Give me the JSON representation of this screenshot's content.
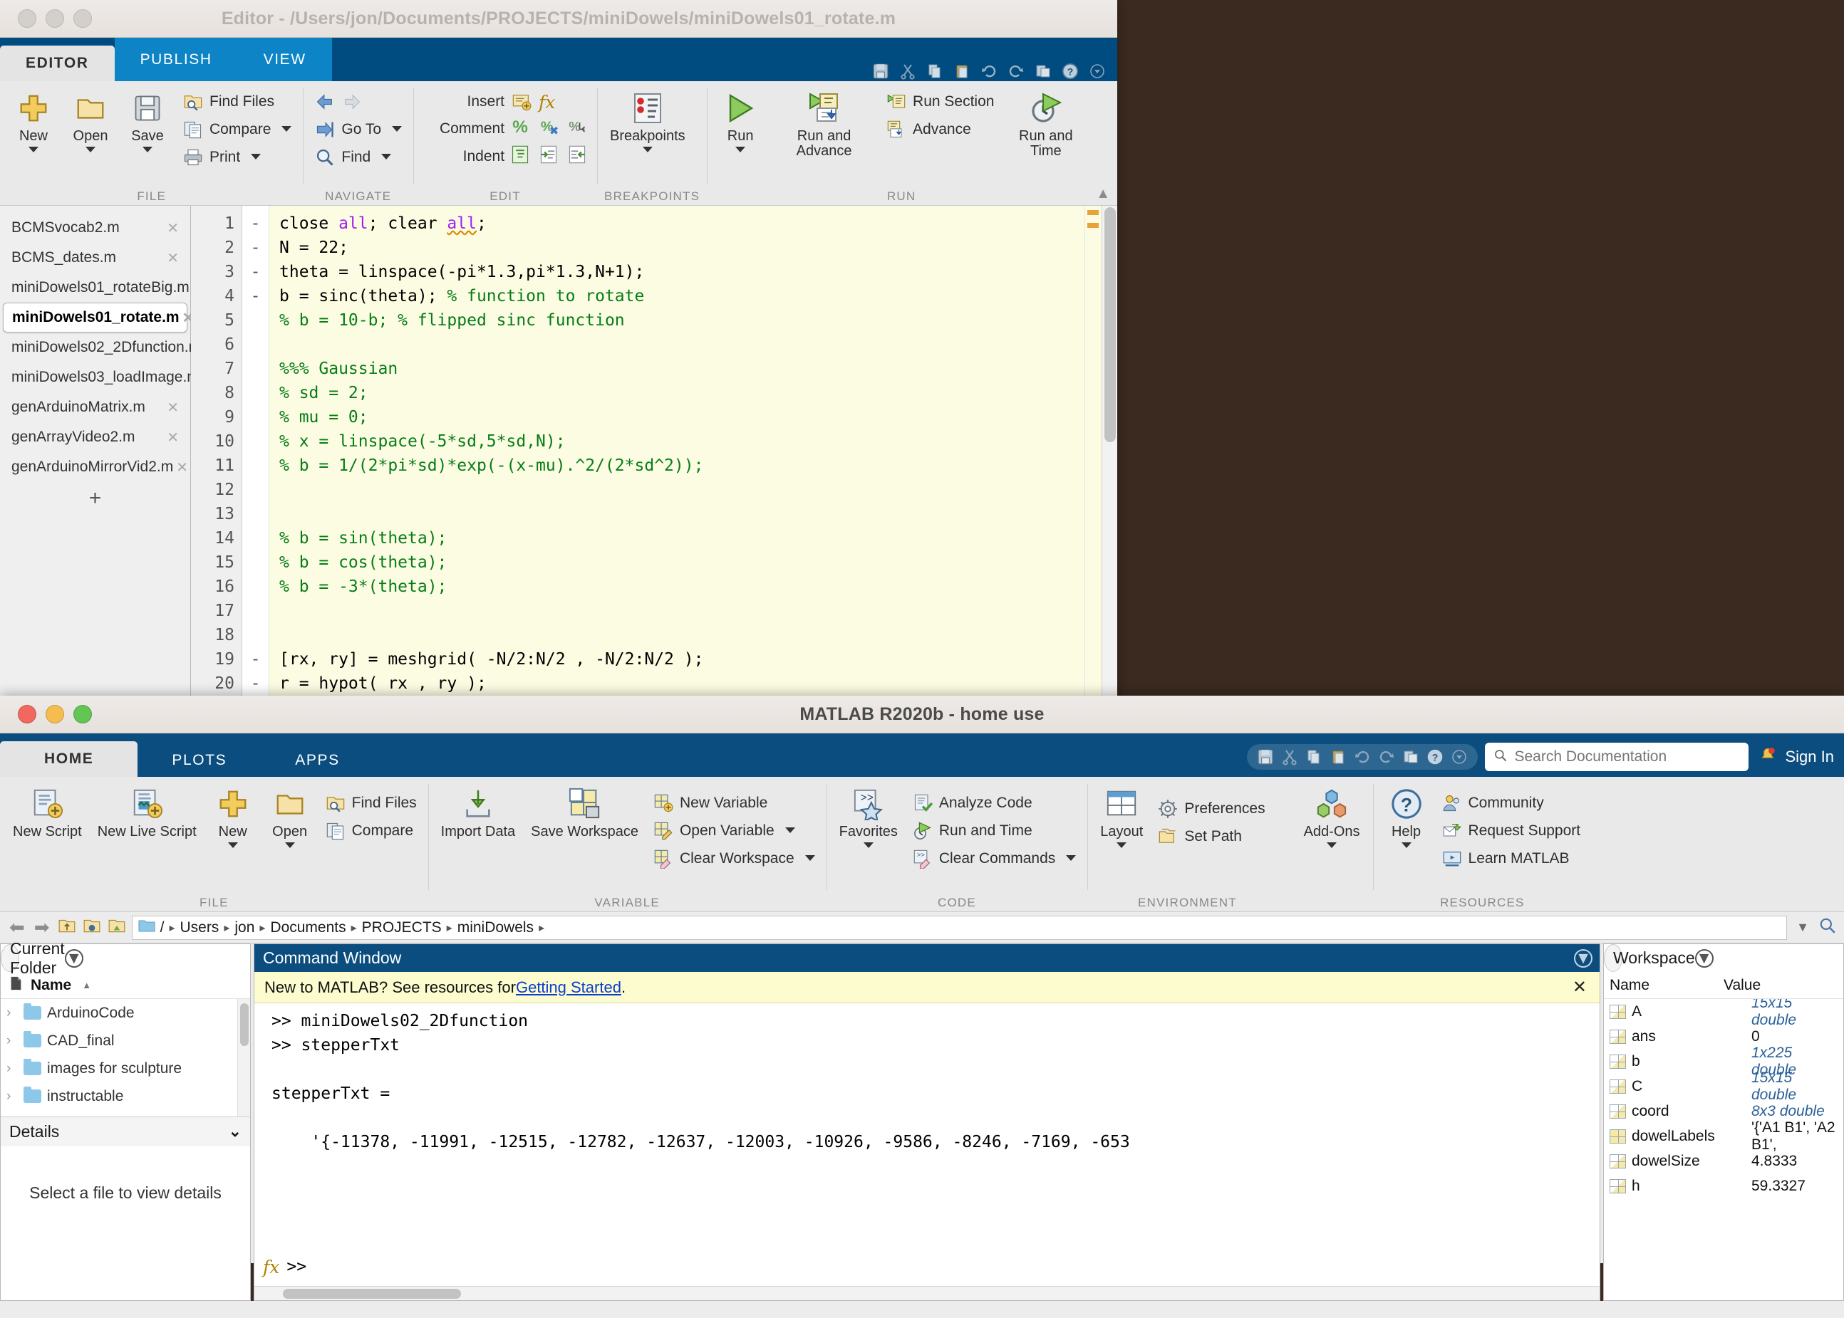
{
  "editor_window": {
    "title": "Editor - /Users/jon/Documents/PROJECTS/miniDowels/miniDowels01_rotate.m",
    "tabs": [
      {
        "label": "EDITOR",
        "active": true
      },
      {
        "label": "PUBLISH",
        "active": false
      },
      {
        "label": "VIEW",
        "active": false
      }
    ],
    "ribbon_groups": [
      {
        "name": "FILE",
        "big_buttons": [
          {
            "label": "New",
            "icon": "new-plus-icon",
            "has_caret": true
          },
          {
            "label": "Open",
            "icon": "open-folder-icon",
            "has_caret": true
          },
          {
            "label": "Save",
            "icon": "save-disk-icon",
            "has_caret": true
          }
        ],
        "small_buttons": [
          {
            "label": "Find Files",
            "icon": "find-files-icon",
            "has_caret": false
          },
          {
            "label": "Compare",
            "icon": "compare-icon",
            "has_caret": true
          },
          {
            "label": "Print",
            "icon": "print-icon",
            "has_caret": true
          }
        ]
      },
      {
        "name": "NAVIGATE",
        "small_buttons": [
          {
            "label": "",
            "icon": "back-arrow-icon",
            "has_caret": false
          },
          {
            "label": "Go To",
            "icon": "goto-icon",
            "has_caret": true
          },
          {
            "label": "Find",
            "icon": "find-magnifier-icon",
            "has_caret": true
          }
        ]
      },
      {
        "name": "EDIT",
        "rows": [
          {
            "label": "Insert",
            "icons": [
              "insert-block-icon",
              "fx-function-icon"
            ]
          },
          {
            "label": "Comment",
            "icons": [
              "comment-percent-icon",
              "uncomment-icon",
              "wrap-comment-icon"
            ]
          },
          {
            "label": "Indent",
            "icons": [
              "smart-indent-icon",
              "indent-right-icon",
              "indent-left-icon"
            ]
          }
        ]
      },
      {
        "name": "BREAKPOINTS",
        "big_buttons": [
          {
            "label": "Breakpoints",
            "icon": "breakpoints-icon",
            "has_caret": true
          }
        ]
      },
      {
        "name": "RUN",
        "big_buttons": [
          {
            "label": "Run",
            "icon": "run-play-icon",
            "has_caret": true
          },
          {
            "label": "Run and Advance",
            "icon": "run-advance-icon",
            "has_caret": false
          },
          {
            "label": "Run and Time",
            "icon": "run-time-icon",
            "has_caret": false
          }
        ],
        "small_buttons": [
          {
            "label": "Run Section",
            "icon": "run-section-icon",
            "has_caret": false
          },
          {
            "label": "Advance",
            "icon": "advance-icon",
            "has_caret": false
          }
        ]
      }
    ],
    "file_list": [
      {
        "name": "BCMSvocab2.m",
        "selected": false
      },
      {
        "name": "BCMS_dates.m",
        "selected": false
      },
      {
        "name": "miniDowels01_rotateBig.m",
        "selected": false
      },
      {
        "name": "miniDowels01_rotate.m",
        "selected": true
      },
      {
        "name": "miniDowels02_2Dfunction.m",
        "selected": false
      },
      {
        "name": "miniDowels03_loadImage.m",
        "selected": false
      },
      {
        "name": "genArduinoMatrix.m",
        "selected": false
      },
      {
        "name": "genArrayVideo2.m",
        "selected": false
      },
      {
        "name": "genArduinoMirrorVid2.m",
        "selected": false
      }
    ],
    "add_tab_label": "+",
    "code_lines": [
      {
        "n": "1",
        "bp": "-",
        "segs": [
          {
            "t": "close ",
            "c": "p"
          },
          {
            "t": "all",
            "c": "k"
          },
          {
            "t": "; clear ",
            "c": "p"
          },
          {
            "t": "all",
            "c": "kw"
          },
          {
            "t": ";",
            "c": "p"
          }
        ]
      },
      {
        "n": "2",
        "bp": "-",
        "segs": [
          {
            "t": "N = 22;",
            "c": "p"
          }
        ]
      },
      {
        "n": "3",
        "bp": "-",
        "segs": [
          {
            "t": "theta = linspace(-pi*1.3,pi*1.3,N+1);",
            "c": "p"
          }
        ]
      },
      {
        "n": "4",
        "bp": "-",
        "segs": [
          {
            "t": "b = sinc(theta); ",
            "c": "p"
          },
          {
            "t": "% function to rotate",
            "c": "c"
          }
        ]
      },
      {
        "n": "5",
        "bp": "",
        "segs": [
          {
            "t": "% b = 10-b; % flipped sinc function",
            "c": "c"
          }
        ]
      },
      {
        "n": "6",
        "bp": "",
        "segs": [
          {
            "t": "",
            "c": "p"
          }
        ]
      },
      {
        "n": "7",
        "bp": "",
        "segs": [
          {
            "t": "%%% Gaussian",
            "c": "c"
          }
        ]
      },
      {
        "n": "8",
        "bp": "",
        "segs": [
          {
            "t": "% sd = 2;",
            "c": "c"
          }
        ]
      },
      {
        "n": "9",
        "bp": "",
        "segs": [
          {
            "t": "% mu = 0;",
            "c": "c"
          }
        ]
      },
      {
        "n": "10",
        "bp": "",
        "segs": [
          {
            "t": "% x = linspace(-5*sd,5*sd,N);",
            "c": "c"
          }
        ]
      },
      {
        "n": "11",
        "bp": "",
        "segs": [
          {
            "t": "% b = 1/(2*pi*sd)*exp(-(x-mu).^2/(2*sd^2));",
            "c": "c"
          }
        ]
      },
      {
        "n": "12",
        "bp": "",
        "segs": [
          {
            "t": "",
            "c": "p"
          }
        ]
      },
      {
        "n": "13",
        "bp": "",
        "segs": [
          {
            "t": "",
            "c": "p"
          }
        ]
      },
      {
        "n": "14",
        "bp": "",
        "segs": [
          {
            "t": "% b = sin(theta);",
            "c": "c"
          }
        ]
      },
      {
        "n": "15",
        "bp": "",
        "segs": [
          {
            "t": "% b = cos(theta);",
            "c": "c"
          }
        ]
      },
      {
        "n": "16",
        "bp": "",
        "segs": [
          {
            "t": "% b = -3*(theta);",
            "c": "c"
          }
        ]
      },
      {
        "n": "17",
        "bp": "",
        "segs": [
          {
            "t": "",
            "c": "p"
          }
        ]
      },
      {
        "n": "18",
        "bp": "",
        "segs": [
          {
            "t": "",
            "c": "p"
          }
        ]
      },
      {
        "n": "19",
        "bp": "-",
        "segs": [
          {
            "t": "[rx, ry] = meshgrid( -N/2:N/2 , -N/2:N/2 );",
            "c": "p"
          }
        ]
      },
      {
        "n": "20",
        "bp": "-",
        "segs": [
          {
            "t": "r = hypot( rx , ry );",
            "c": "p"
          }
        ]
      }
    ]
  },
  "matlab_window": {
    "title": "MATLAB R2020b - home use",
    "tabs": [
      {
        "label": "HOME",
        "active": true
      },
      {
        "label": "PLOTS",
        "active": false
      },
      {
        "label": "APPS",
        "active": false
      }
    ],
    "search": {
      "placeholder": "Search Documentation",
      "value": ""
    },
    "sign_in_label": "Sign In",
    "ribbon_groups": [
      {
        "name": "FILE",
        "big_buttons": [
          {
            "label": "New Script",
            "icon": "new-script-icon",
            "has_caret": false
          },
          {
            "label": "New Live Script",
            "icon": "new-live-script-icon",
            "has_caret": false
          },
          {
            "label": "New",
            "icon": "new-plus-icon",
            "has_caret": true
          },
          {
            "label": "Open",
            "icon": "open-folder-icon",
            "has_caret": true
          }
        ],
        "small_buttons": [
          {
            "label": "Find Files",
            "icon": "find-files-icon",
            "has_caret": false
          },
          {
            "label": "Compare",
            "icon": "compare-icon",
            "has_caret": false
          }
        ]
      },
      {
        "name": "VARIABLE",
        "big_buttons": [
          {
            "label": "Import Data",
            "icon": "import-data-icon",
            "has_caret": false
          },
          {
            "label": "Save Workspace",
            "icon": "save-workspace-icon",
            "has_caret": false
          }
        ],
        "small_buttons": [
          {
            "label": "New Variable",
            "icon": "new-variable-icon",
            "has_caret": false
          },
          {
            "label": "Open Variable",
            "icon": "open-variable-icon",
            "has_caret": true
          },
          {
            "label": "Clear Workspace",
            "icon": "clear-workspace-icon",
            "has_caret": true
          }
        ]
      },
      {
        "name": "CODE",
        "big_buttons": [
          {
            "label": "Favorites",
            "icon": "favorites-star-icon",
            "has_caret": true
          }
        ],
        "small_buttons": [
          {
            "label": "Analyze Code",
            "icon": "analyze-code-icon",
            "has_caret": false
          },
          {
            "label": "Run and Time",
            "icon": "run-time-icon",
            "has_caret": false
          },
          {
            "label": "Clear Commands",
            "icon": "clear-commands-icon",
            "has_caret": true
          }
        ]
      },
      {
        "name": "ENVIRONMENT",
        "big_buttons": [
          {
            "label": "Layout",
            "icon": "layout-icon",
            "has_caret": true
          }
        ],
        "small_buttons": [
          {
            "label": "Preferences",
            "icon": "gear-icon",
            "has_caret": false
          },
          {
            "label": "Set Path",
            "icon": "set-path-icon",
            "has_caret": false
          }
        ]
      },
      {
        "name": "",
        "big_buttons": [
          {
            "label": "Add-Ons",
            "icon": "add-ons-icon",
            "has_caret": true
          }
        ]
      },
      {
        "name": "RESOURCES",
        "big_buttons": [
          {
            "label": "Help",
            "icon": "help-icon",
            "has_caret": true
          }
        ],
        "small_buttons": [
          {
            "label": "Community",
            "icon": "community-icon",
            "has_caret": false
          },
          {
            "label": "Request Support",
            "icon": "request-support-icon",
            "has_caret": false
          },
          {
            "label": "Learn MATLAB",
            "icon": "learn-matlab-icon",
            "has_caret": false
          }
        ]
      }
    ],
    "breadcrumb": {
      "root": "/",
      "segments": [
        "Users",
        "jon",
        "Documents",
        "PROJECTS",
        "miniDowels"
      ]
    },
    "current_folder": {
      "title": "Current Folder",
      "column_header": "Name",
      "items": [
        {
          "name": "ArduinoCode"
        },
        {
          "name": "CAD_final"
        },
        {
          "name": "images for sculpture"
        },
        {
          "name": "instructable"
        }
      ],
      "details_label": "Details",
      "details_placeholder": "Select a file to view details"
    },
    "command_window": {
      "title": "Command Window",
      "notice_prefix": "New to MATLAB? See resources for ",
      "notice_link": "Getting Started",
      "notice_suffix": ".",
      "lines": [
        ">> miniDowels02_2Dfunction",
        ">> stepperTxt",
        "",
        "stepperTxt =",
        "",
        "    '{-11378, -11991, -12515, -12782, -12637, -12003, -10926, -9586, -8246, -7169, -653"
      ],
      "prompt": ">>"
    },
    "workspace": {
      "title": "Workspace",
      "columns": [
        "Name",
        "Value"
      ],
      "rows": [
        {
          "name": "A",
          "value": "15x15 double",
          "dim": true,
          "icon": "matrix-icon"
        },
        {
          "name": "ans",
          "value": "0",
          "dim": false,
          "icon": "matrix-icon"
        },
        {
          "name": "b",
          "value": "1x225 double",
          "dim": true,
          "icon": "matrix-icon"
        },
        {
          "name": "C",
          "value": "15x15 double",
          "dim": true,
          "icon": "matrix-icon"
        },
        {
          "name": "coord",
          "value": "8x3 double",
          "dim": true,
          "icon": "matrix-icon"
        },
        {
          "name": "dowelLabels",
          "value": "'{'A1 B1', 'A2 B1',",
          "dim": false,
          "icon": "cell-icon"
        },
        {
          "name": "dowelSize",
          "value": "4.8333",
          "dim": false,
          "icon": "matrix-icon"
        },
        {
          "name": "h",
          "value": "59.3327",
          "dim": false,
          "icon": "matrix-icon"
        }
      ]
    }
  },
  "colors": {
    "ribbon_blue": "#0b4d7f",
    "editor_blue": "#004b7f",
    "tab_alt_blue": "#0c84c6",
    "code_bg": "#fcfce3",
    "comment_green": "#067d17",
    "keyword_purple": "#a020f0",
    "notice_yellow": "#fcfccf",
    "link_blue": "#0b3ecc",
    "value_blue": "#2a6099"
  }
}
